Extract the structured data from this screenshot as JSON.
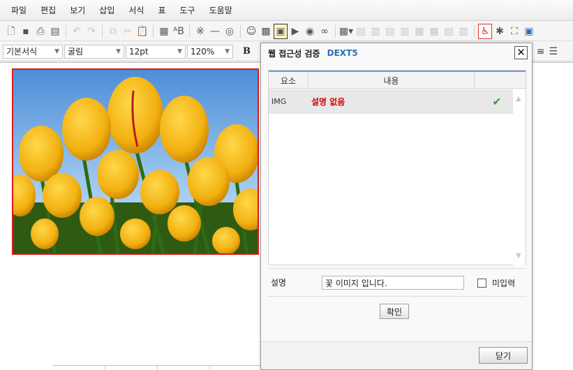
{
  "menu": [
    "파일",
    "편집",
    "보기",
    "삽입",
    "서식",
    "표",
    "도구",
    "도움말"
  ],
  "toolbar2": {
    "style": "기본서식",
    "font": "굴림",
    "size": "12pt",
    "zoom": "120%",
    "bold": "B"
  },
  "dialog": {
    "title": "웹 접근성 검증",
    "brand": "DEXT5",
    "columns": [
      "요소",
      "내용"
    ],
    "row": {
      "tag": "IMG",
      "value": "설명 없음"
    },
    "desc_label": "설명",
    "desc_value": "꽃 이미지 입니다.",
    "no_input_label": "미입력",
    "confirm_label": "확인",
    "close_label": "닫기"
  },
  "colors": {
    "accent": "#2c6fb8",
    "error": "#d60000",
    "ok": "#3aa13a"
  }
}
